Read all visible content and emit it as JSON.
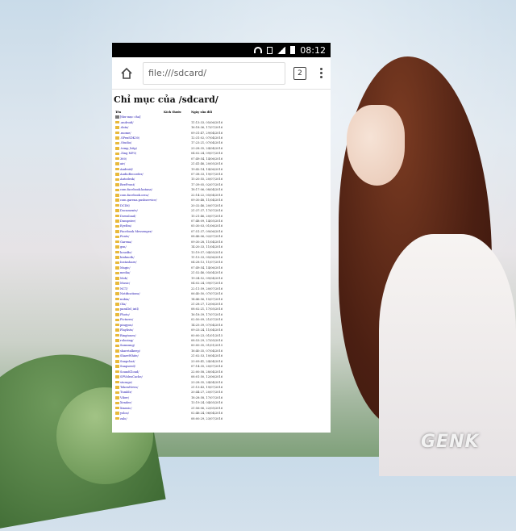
{
  "status_bar": {
    "time": "08:12"
  },
  "browser": {
    "url": "file:///sdcard/",
    "tab_count": "2"
  },
  "page": {
    "title": "Chỉ mục của /sdcard/",
    "columns": [
      "Tên",
      "Kích thước",
      "Ngày sửa đổi"
    ],
    "parent_link": "[thư mục cha]",
    "rows": [
      {
        "name": ".android/",
        "date": "11:13:33, 05/06/2016"
      },
      {
        "name": ".data/",
        "date": "16:18:36, 17/07/2016"
      },
      {
        "name": ".mome/",
        "date": "09:31:47, 29/04/2016"
      },
      {
        "name": ".SPenSDK30/",
        "date": "12:31:02, 07/04/2016"
      },
      {
        "name": ".Studio/",
        "date": "17:23:21, 07/04/2016"
      },
      {
        "name": ".temp_http/",
        "date": "23:28:35, 24/04/2016"
      },
      {
        "name": ".Zing MP3/",
        "date": "04:02:24, 09/07/2016"
      },
      {
        "name": "360/",
        "date": "07:49:54, 14/06/2016"
      },
      {
        "name": "air/",
        "date": "21:41:46, 20/05/2016"
      },
      {
        "name": "Android/",
        "date": "19:42:14, 14/06/2016"
      },
      {
        "name": "AudioRecorder/",
        "date": "07:38:33, 19/07/2016"
      },
      {
        "name": "Autodesk/",
        "date": "15:20:55, 20/07/2016"
      },
      {
        "name": "BeeFront/",
        "date": "17:39:05, 02/07/2016"
      },
      {
        "name": "com.facebook.katana/",
        "date": "18:17:06, 08/04/2016"
      },
      {
        "name": "com.facebook.orca/",
        "date": "22:14:22, 05/04/2016"
      },
      {
        "name": "com.garena.pushservice/",
        "date": "09:30:48, 11/04/2016"
      },
      {
        "name": "DCIM/",
        "date": "20:32:46, 20/07/2016"
      },
      {
        "name": "Documents/",
        "date": "21:37:37, 17/07/2016"
      },
      {
        "name": "Download/",
        "date": "15:21:46, 20/07/2016"
      },
      {
        "name": "Dumpster/",
        "date": "07:48:09, 14/05/2016"
      },
      {
        "name": "EyeEm/",
        "date": "05:30:03, 01/06/2016"
      },
      {
        "name": "Facebook Messenger/",
        "date": "07:51:37, 09/06/2016"
      },
      {
        "name": "Fonts/",
        "date": "08:46:06, 02/07/2016"
      },
      {
        "name": "Garena/",
        "date": "09:30:28, 11/04/2016"
      },
      {
        "name": "gsn/",
        "date": "14:20:33, 11/04/2016"
      },
      {
        "name": "housBe/",
        "date": "13:19:57, 04/05/2016"
      },
      {
        "name": "hinhnoth/",
        "date": "11:13:33, 05/06/2016"
      },
      {
        "name": "Instashare/",
        "date": "04:28:13, 11/07/2016"
      },
      {
        "name": "Magic/",
        "date": "07:49:54, 14/06/2016"
      },
      {
        "name": "media/",
        "date": "21:52:46, 05/04/2016"
      },
      {
        "name": "Mob/",
        "date": "19:34:52, 09/04/2016"
      },
      {
        "name": "Music/",
        "date": "04:02:24, 09/07/2016"
      },
      {
        "name": "NCT/",
        "date": "22:11:59, 20/07/2016"
      },
      {
        "name": "Notifications/",
        "date": "06:40:50, 07/07/2016"
      },
      {
        "name": "nubia/",
        "date": "14:46:56, 15/07/2016"
      },
      {
        "name": "Ola/",
        "date": "21:28:27, 12/06/2016"
      },
      {
        "name": "parallel_intl/",
        "date": "08:02:21, 17/05/2016"
      },
      {
        "name": "Photo/",
        "date": "16:18:39, 17/07/2016"
      },
      {
        "name": "Pictures/",
        "date": "02:50:09, 21/07/2016"
      },
      {
        "name": "pingyon/",
        "date": "14:25:39, 07/04/2016"
      },
      {
        "name": "Playlists/",
        "date": "09:33:24, 11/04/2016"
      },
      {
        "name": "Ringtones/",
        "date": "00:00:23, 01/01/2015"
      },
      {
        "name": "rolooing/",
        "date": "08:53:29, 27/05/2016"
      },
      {
        "name": "Samsung/",
        "date": "00:00:35, 01/01/2015"
      },
      {
        "name": "sharetalkeep/",
        "date": "16:40:35, 07/04/2016"
      },
      {
        "name": "ShareWhite/",
        "date": "21:02:53, 10/04/2016"
      },
      {
        "name": "Snapchat/",
        "date": "23:09:41, 24/04/2016"
      },
      {
        "name": "Snapseed/",
        "date": "07:14:35, 20/07/2016"
      },
      {
        "name": "SoundCloud/",
        "date": "22:00:58, 28/04/2016"
      },
      {
        "name": "SPVideoCache/",
        "date": "08:01:50, 12/06/2016"
      },
      {
        "name": "storage/",
        "date": "23:28:35, 24/04/2016"
      },
      {
        "name": "TokenNews/",
        "date": "21:13:43, 19/07/2016"
      },
      {
        "name": "Tumblr/",
        "date": "20:44:27, 20/07/2016"
      },
      {
        "name": "Viber/",
        "date": "18:28:58, 17/07/2016"
      },
      {
        "name": "Xender/",
        "date": "13:19:24, 04/05/2016"
      },
      {
        "name": "Xmusic/",
        "date": "21:56:06, 22/05/2016"
      },
      {
        "name": "yoloo/",
        "date": "02:46:24, 06/04/2016"
      },
      {
        "name": "zalo/",
        "date": "08:00:29, 23/07/2016"
      }
    ]
  },
  "watermark": "GENK",
  "colors": {
    "link": "#1a0dab",
    "folder": "#e8b93a",
    "status_bar": "#000000"
  },
  "icons": [
    "wifi-icon",
    "sim-icon",
    "signal-icon",
    "battery-icon",
    "home-icon",
    "tabs-icon",
    "overflow-menu-icon",
    "folder-icon",
    "parent-folder-icon"
  ]
}
